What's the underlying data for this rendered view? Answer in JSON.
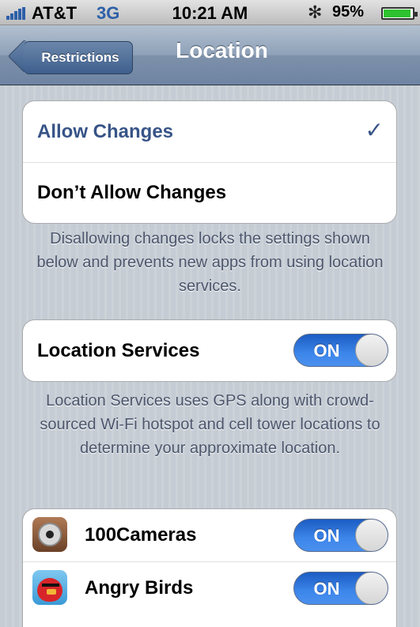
{
  "status_bar": {
    "carrier": "AT&T",
    "network": "3G",
    "time": "10:21 AM",
    "bluetooth_icon": "✻",
    "battery_percent": "95%",
    "battery_level": 0.95
  },
  "nav": {
    "back_label": "Restrictions",
    "title": "Location"
  },
  "changes_group": {
    "options": [
      {
        "label": "Allow Changes",
        "selected": true
      },
      {
        "label": "Don’t Allow Changes",
        "selected": false
      }
    ],
    "checkmark": "✓",
    "footer": "Disallowing changes locks the settings shown below and prevents new apps from using location services."
  },
  "location_services": {
    "label": "Location Services",
    "switch_label": "ON",
    "footer": "Location Services uses GPS along with crowd-sourced Wi-Fi hotspot and cell tower locations to determine your approximate location."
  },
  "apps": [
    {
      "name": "100Cameras",
      "switch_label": "ON",
      "icon": "camera-icon"
    },
    {
      "name": "Angry Birds",
      "switch_label": "ON",
      "icon": "angry-birds-icon"
    }
  ],
  "colors": {
    "accent": "#385487",
    "switch_on": "#3d86ea",
    "background": "#c5ccd4"
  }
}
